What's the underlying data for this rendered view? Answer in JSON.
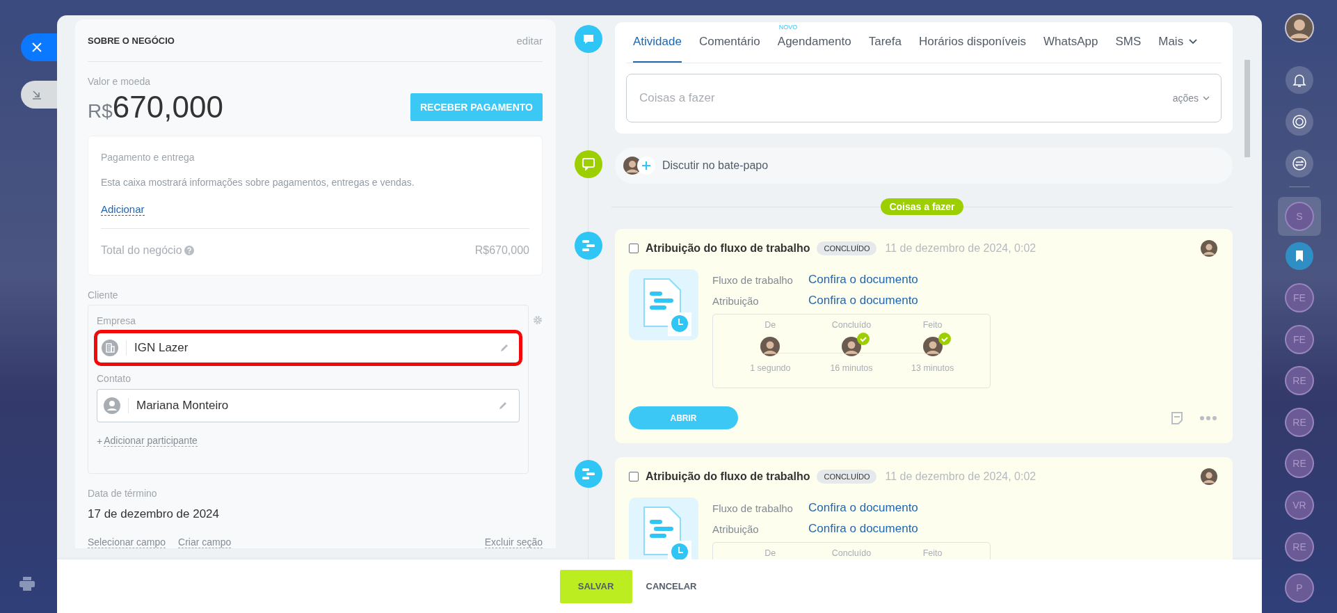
{
  "deal": {
    "title": "SOBRE O NEGÓCIO",
    "edit": "editar",
    "amount_label": "Valor e moeda",
    "currency": "R$",
    "amount": "670,000",
    "pay_button": "RECEBER PAGAMENTO",
    "payment": {
      "title": "Pagamento e entrega",
      "text": "Esta caixa mostrará informações sobre pagamentos, entregas e vendas.",
      "add_link": "Adicionar",
      "total_label": "Total do negócio",
      "total": "R$670,000"
    },
    "client": {
      "label": "Cliente",
      "fields": [
        {
          "kind": "company",
          "label": "Empresa",
          "value": "IGN Lazer",
          "highlighted": true
        },
        {
          "kind": "contact",
          "label": "Contato",
          "value": "Mariana Monteiro",
          "highlighted": false
        }
      ],
      "add_participant": {
        "icon": "+",
        "label": "Adicionar participante"
      }
    },
    "end_date": {
      "label": "Data de término",
      "value": "17 de dezembro de 2024"
    },
    "links": [
      "Selecionar campo",
      "Criar campo"
    ],
    "delete_section": "Excluir seção"
  },
  "timeline": {
    "tabs": [
      {
        "label": "Atividade",
        "selected": true
      },
      {
        "label": "Comentário",
        "selected": false
      },
      {
        "label": "Agendamento",
        "selected": false,
        "badge": "NOVO"
      },
      {
        "label": "Tarefa",
        "selected": false
      },
      {
        "label": "Horários disponíveis",
        "selected": false
      },
      {
        "label": "WhatsApp",
        "selected": false
      },
      {
        "label": "SMS",
        "selected": false
      },
      {
        "label": "Mais",
        "selected": false,
        "kind": "more"
      }
    ],
    "input": {
      "placeholder": "Coisas a fazer",
      "actions": "ações"
    },
    "chat": "Discutir no bate-papo",
    "section_badge": "Coisas a fazer",
    "activities": [
      {
        "title": "Atribuição do fluxo de trabalho",
        "checked": false,
        "status": "CONCLUÍDO",
        "date": "11 de dezembro de 2024, 0:02",
        "fields": [
          {
            "label": "Fluxo de trabalho",
            "link": "Confira o documento"
          },
          {
            "label": "Atribuição",
            "link": "Confira o documento"
          }
        ],
        "stages": [
          {
            "label": "De",
            "done": false,
            "time": "1 segundo"
          },
          {
            "label": "Concluído",
            "done": true,
            "time": "16 minutos"
          },
          {
            "label": "Feito",
            "done": true,
            "time": "13 minutos"
          }
        ],
        "button": "ABRIR"
      },
      {
        "title": "Atribuição do fluxo de trabalho",
        "checked": false,
        "status": "CONCLUÍDO",
        "date": "11 de dezembro de 2024, 0:02",
        "fields": [
          {
            "label": "Fluxo de trabalho",
            "link": "Confira o documento"
          },
          {
            "label": "Atribuição",
            "link": "Confira o documento"
          }
        ],
        "stages": [
          {
            "label": "De"
          },
          {
            "label": "Concluído"
          },
          {
            "label": "Feito"
          }
        ]
      }
    ]
  },
  "footer": {
    "save": "SALVAR",
    "cancel": "CANCELAR"
  },
  "right_bar": [
    {
      "kind": "avatar",
      "selected": false
    },
    {
      "kind": "bell",
      "selected": false
    },
    {
      "kind": "copilot",
      "selected": false
    },
    {
      "kind": "sync-chat",
      "selected": false
    },
    {
      "kind": "initials",
      "label": "S",
      "selected": true
    },
    {
      "kind": "bookmark",
      "selected": false
    },
    {
      "kind": "initials",
      "label": "FE",
      "selected": false
    },
    {
      "kind": "initials",
      "label": "FE",
      "selected": false
    },
    {
      "kind": "initials",
      "label": "RE",
      "selected": false
    },
    {
      "kind": "initials",
      "label": "RE",
      "selected": false
    },
    {
      "kind": "initials",
      "label": "RE",
      "selected": false
    },
    {
      "kind": "initials",
      "label": "VR",
      "selected": false
    },
    {
      "kind": "initials",
      "label": "RE",
      "selected": false
    },
    {
      "kind": "initials",
      "label": "P",
      "selected": false
    }
  ]
}
